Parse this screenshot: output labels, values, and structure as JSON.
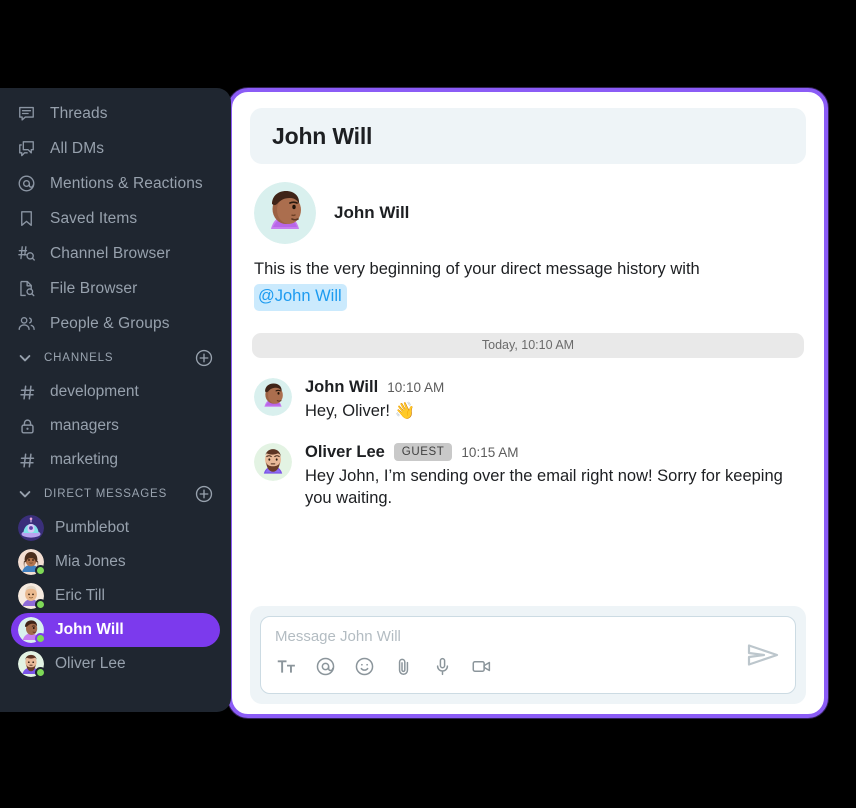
{
  "sidebar": {
    "nav": [
      {
        "label": "Threads",
        "icon": "threads-icon"
      },
      {
        "label": "All DMs",
        "icon": "all-dms-icon"
      },
      {
        "label": "Mentions & Reactions",
        "icon": "at-mention-icon"
      },
      {
        "label": "Saved Items",
        "icon": "bookmark-icon"
      },
      {
        "label": "Channel Browser",
        "icon": "channel-browser-icon"
      },
      {
        "label": "File Browser",
        "icon": "file-browser-icon"
      },
      {
        "label": "People & Groups",
        "icon": "people-groups-icon"
      }
    ],
    "channels_section": {
      "title": "CHANNELS",
      "add_label": "+",
      "items": [
        {
          "label": "development",
          "icon": "hash-icon"
        },
        {
          "label": "managers",
          "icon": "lock-icon"
        },
        {
          "label": "marketing",
          "icon": "hash-icon"
        }
      ]
    },
    "dms_section": {
      "title": "DIRECT MESSAGES",
      "add_label": "+",
      "items": [
        {
          "label": "Pumblebot",
          "avatar": "bot",
          "online": false,
          "active": false
        },
        {
          "label": "Mia Jones",
          "avatar": "mia",
          "online": true,
          "active": false
        },
        {
          "label": "Eric Till",
          "avatar": "eric",
          "online": true,
          "active": false
        },
        {
          "label": "John Will",
          "avatar": "john",
          "online": true,
          "active": true
        },
        {
          "label": "Oliver Lee",
          "avatar": "oliver",
          "online": true,
          "active": false
        }
      ]
    }
  },
  "chat": {
    "header_title": "John Will",
    "intro": {
      "name": "John Will",
      "text": "This is the very beginning of your direct message history with",
      "mention": "@John Will"
    },
    "date_divider": "Today, 10:10 AM",
    "messages": [
      {
        "author": "John Will",
        "badge": "",
        "time": "10:10 AM",
        "text": "Hey, Oliver! 👋",
        "avatar": "john"
      },
      {
        "author": "Oliver Lee",
        "badge": "GUEST",
        "time": "10:15 AM",
        "text": "Hey John, I’m sending over the email right now! Sorry for keeping you waiting.",
        "avatar": "oliver"
      }
    ],
    "composer": {
      "placeholder": "Message John Will",
      "tools": [
        {
          "icon": "formatting-icon",
          "label": "Tt"
        },
        {
          "icon": "mention-icon",
          "label": "@"
        },
        {
          "icon": "emoji-icon",
          "label": "emoji"
        },
        {
          "icon": "attachment-icon",
          "label": "paperclip"
        },
        {
          "icon": "microphone-icon",
          "label": "mic"
        },
        {
          "icon": "video-icon",
          "label": "video"
        }
      ],
      "send_icon": "send-icon"
    }
  },
  "colors": {
    "accent": "#7c3aed",
    "panel_border": "#8b5cf6",
    "sidebar_bg": "#1f2630",
    "header_bg": "#eef4f7",
    "mention_bg": "#cbeafd",
    "mention_fg": "#1d9bf0",
    "online": "#7ed957"
  }
}
